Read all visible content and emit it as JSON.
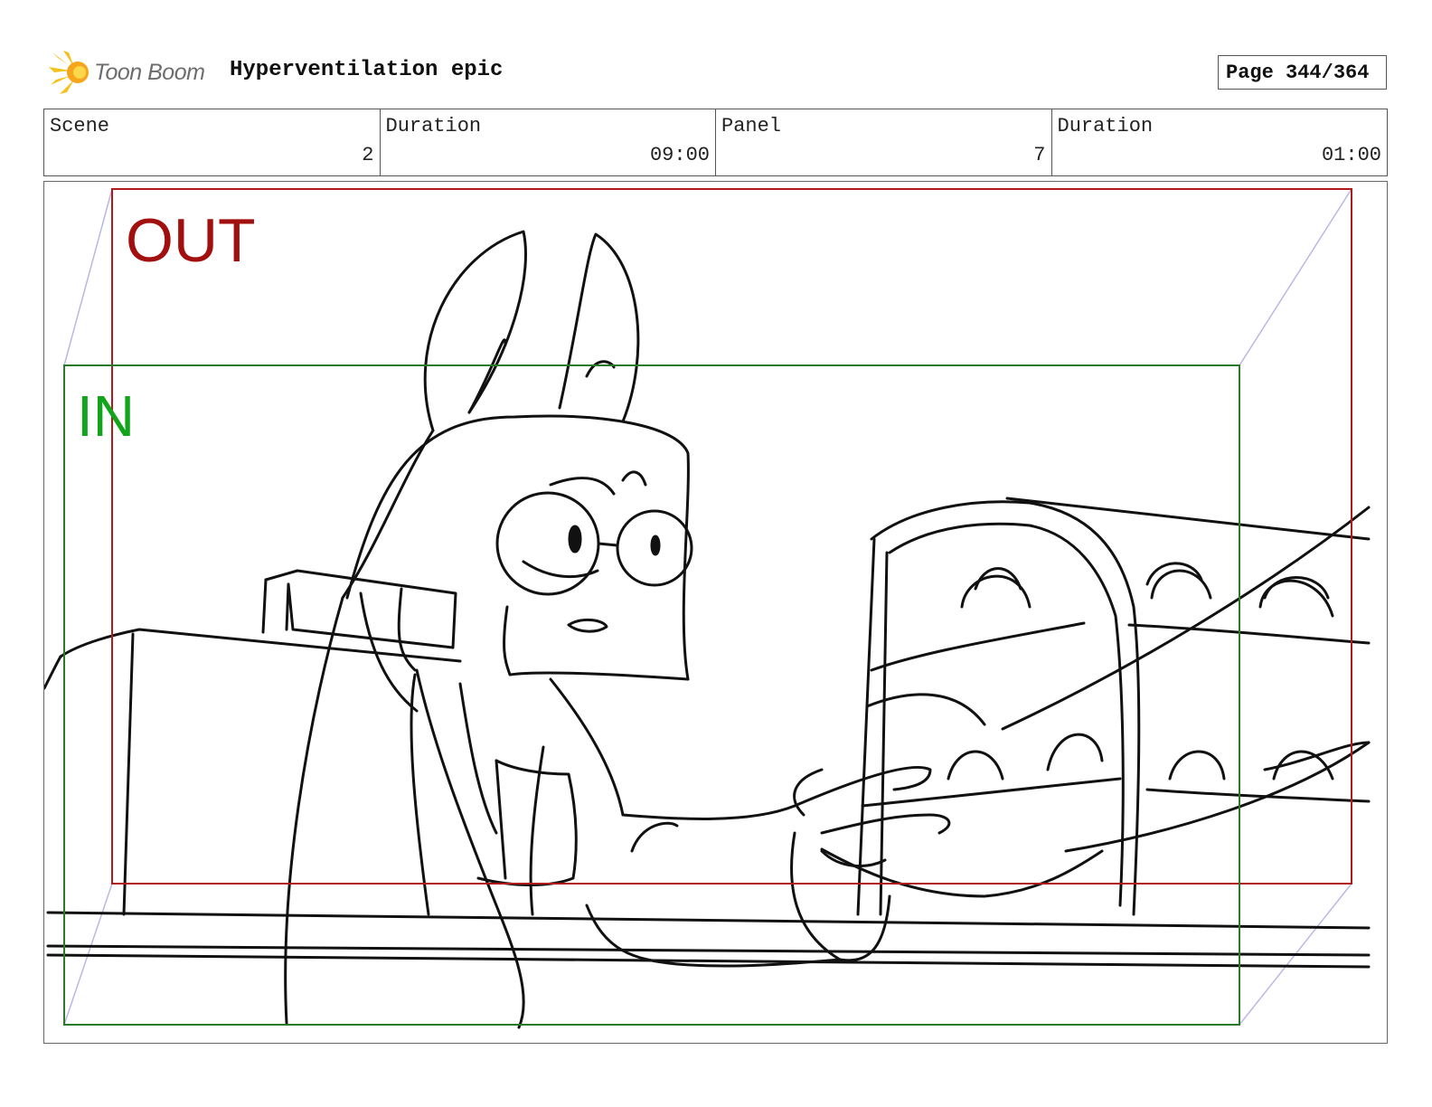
{
  "header": {
    "logo_text": "Toon Boom",
    "project_title": "Hyperventilation epic",
    "page_label": "Page 344/364"
  },
  "info": {
    "scene_label": "Scene",
    "scene_value": "2",
    "scene_duration_label": "Duration",
    "scene_duration_value": "09:00",
    "panel_label": "Panel",
    "panel_value": "7",
    "panel_duration_label": "Duration",
    "panel_duration_value": "01:00"
  },
  "frames": {
    "out_label": "OUT",
    "in_label": "IN"
  },
  "colors": {
    "out_frame": "#b01a1a",
    "in_frame": "#2a7a2a",
    "perspective": "#b8b8e6"
  }
}
